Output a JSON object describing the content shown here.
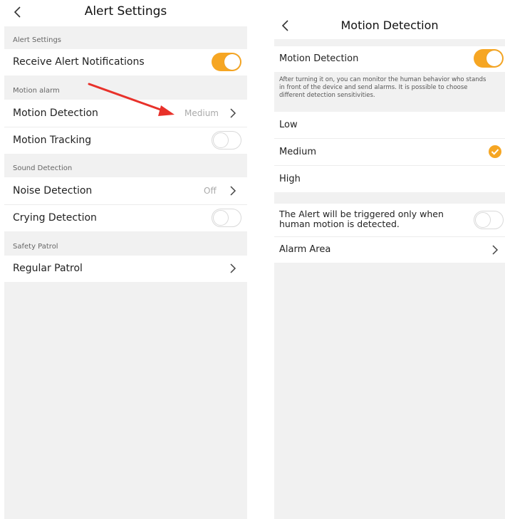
{
  "left": {
    "title": "Alert Settings",
    "sections": [
      {
        "label": "Alert Settings"
      },
      {
        "label": "Motion alarm"
      },
      {
        "label": "Sound Detection"
      },
      {
        "label": "Safety Patrol"
      }
    ],
    "rows": {
      "receive_alert": {
        "label": "Receive Alert Notifications",
        "state": "on"
      },
      "motion_detection": {
        "label": "Motion Detection",
        "value": "Medium"
      },
      "motion_tracking": {
        "label": "Motion Tracking",
        "state": "off"
      },
      "noise_detection": {
        "label": "Noise Detection",
        "value": "Off"
      },
      "crying_detection": {
        "label": "Crying Detection",
        "state": "off"
      },
      "regular_patrol": {
        "label": "Regular Patrol"
      }
    }
  },
  "right": {
    "title": "Motion Detection",
    "motion_detection": {
      "label": "Motion Detection",
      "state": "on"
    },
    "description": "After turning it on, you can monitor the human behavior who stands in front of the device and send alarms. It is possible to choose different detection sensitivities.",
    "sensitivity": [
      {
        "label": "Low",
        "selected": false
      },
      {
        "label": "Medium",
        "selected": true
      },
      {
        "label": "High",
        "selected": false
      }
    ],
    "human_only": {
      "label": "The Alert will be triggered only when human motion is detected.",
      "state": "off"
    },
    "alarm_area": {
      "label": "Alarm Area"
    }
  },
  "colors": {
    "accent": "#f6a623",
    "annotation_arrow": "#e8312a",
    "background": "#f1f1f1"
  },
  "icons": [
    "back-chevron-icon",
    "chevron-right-icon",
    "checkmark-icon"
  ]
}
